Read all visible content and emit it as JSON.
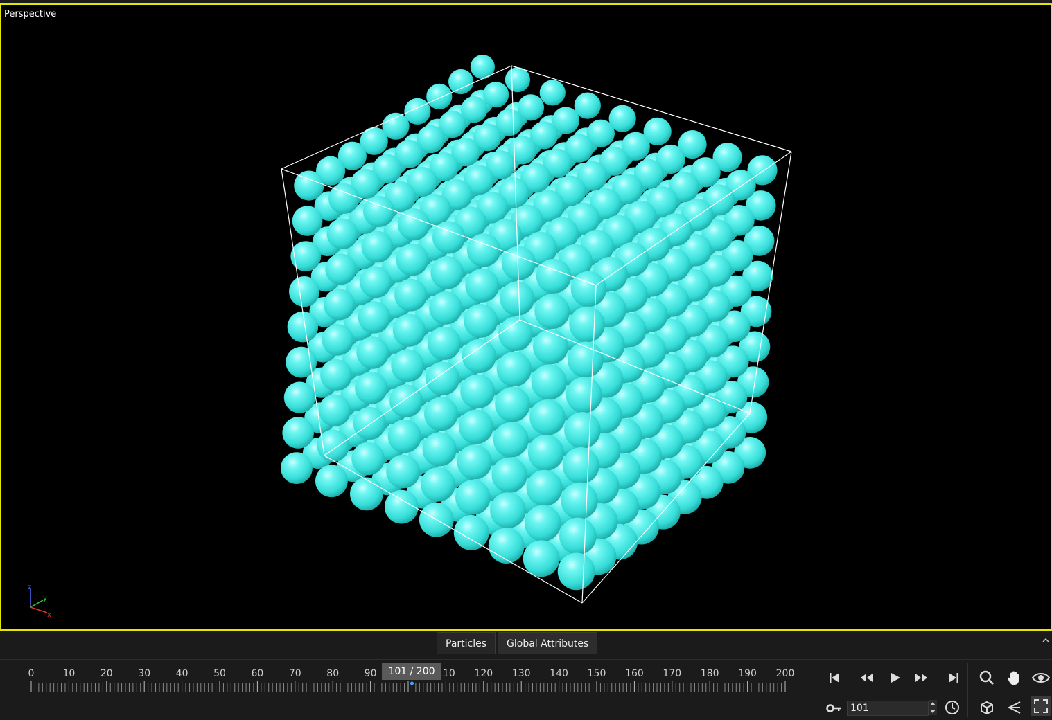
{
  "viewport": {
    "label": "Perspective",
    "border_color": "#e6e600",
    "background": "#000000",
    "particle_color": "#4ff0ec",
    "bounding_box_color": "#ffffff",
    "axis": {
      "z_label": "z",
      "y_label": "y",
      "x_label": "x"
    }
  },
  "panel_tabs": [
    "Particles",
    "Global Attributes"
  ],
  "timeline": {
    "ticks": [
      0,
      10,
      20,
      30,
      40,
      50,
      60,
      70,
      80,
      90,
      110,
      120,
      130,
      140,
      150,
      160,
      170,
      180,
      190,
      200
    ],
    "current_frame": 101,
    "total_frames": 200,
    "badge": "101 / 200"
  },
  "playback": {
    "first_icon": "skip-to-start-icon",
    "rewind_icon": "rewind-icon",
    "play_icon": "play-icon",
    "forward_icon": "fast-forward-icon",
    "last_icon": "skip-to-end-icon"
  },
  "view_tools": [
    "zoom-icon",
    "pan-hand-icon",
    "orbit-eye-icon",
    "frame-object-icon",
    "perspective-icon",
    "maximize-icon"
  ],
  "key_frame_field": {
    "value": "101",
    "icon": "key-icon",
    "clock_icon": "clock-icon"
  }
}
